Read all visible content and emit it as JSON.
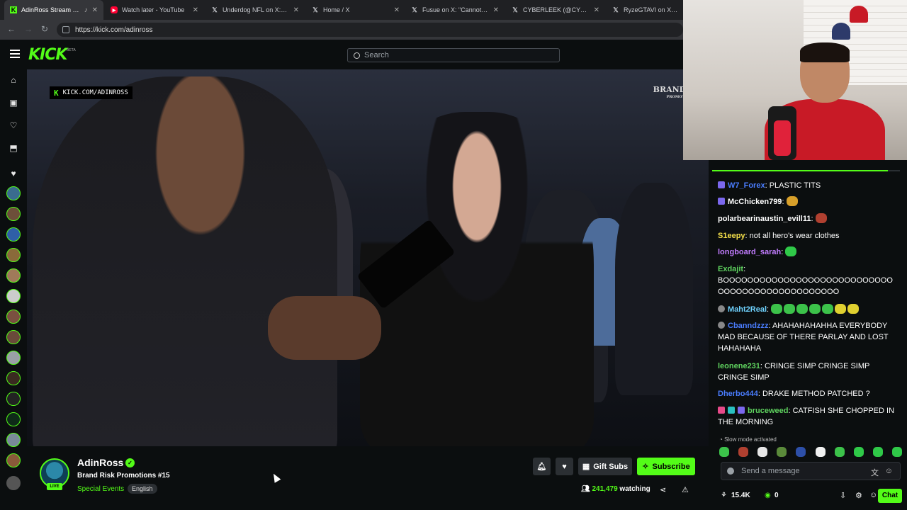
{
  "browser": {
    "tabs": [
      {
        "title": "AdinRoss Stream - Wa",
        "icon": "kick-favicon",
        "active": true
      },
      {
        "title": "Watch later - YouTube",
        "icon": "youtube-favicon"
      },
      {
        "title": "Underdog NFL on X: \"Cee",
        "icon": "x-favicon"
      },
      {
        "title": "Home / X",
        "icon": "x-favicon"
      },
      {
        "title": "Fusue on X: \"Cannot wait",
        "icon": "x-favicon"
      },
      {
        "title": "CYBERLEEK (@CYBERLEEK",
        "icon": "x-favicon"
      },
      {
        "title": "RyzeGTAVI on X: \"New GT",
        "icon": "x-favicon"
      }
    ],
    "url": "https://kick.com/adinross"
  },
  "header": {
    "logo": "KICK",
    "logo_badge": "BETA",
    "search_placeholder": "Search"
  },
  "video": {
    "watermark": "KICK.COM/ADINROSS",
    "brand_logo": "BRANDRISK",
    "brand_sub": "PROMOTIONS"
  },
  "chat": {
    "messages": [
      {
        "user": "W7_Forex",
        "color": "#4a7dff",
        "text": "PLASTIC TITS",
        "badges": [
          "#7b68ee"
        ]
      },
      {
        "user": "McChicken799",
        "color": "#ffffff",
        "text": "",
        "emotes": [
          "#d8a02a"
        ],
        "badges": [
          "#7b68ee"
        ]
      },
      {
        "user": "polarbearinaustin_evill11",
        "color": "#ffffff",
        "text": "",
        "emotes": [
          "#b04030"
        ]
      },
      {
        "user": "S1eepy",
        "color": "#f5e04a",
        "text": "not all hero's wear clothes"
      },
      {
        "user": "longboard_sarah",
        "color": "#c27cff",
        "text": "",
        "emotes": [
          "#2fc948"
        ]
      },
      {
        "user": "Exdajit",
        "color": "#5fd35f",
        "text": "BOOOOOOOOOOOOOOOOOOOOOOOOOOOOOOOOOOOOOOOOOOOOOOOO"
      },
      {
        "user": "Maht2Real",
        "color": "#6fd3ff",
        "text": "",
        "emotes": [
          "#3cc24a",
          "#3cc24a",
          "#3cc24a",
          "#3cc24a",
          "#3cc24a",
          "#e0d030",
          "#e0d030"
        ],
        "badges": [
          "#888888"
        ]
      },
      {
        "user": "Cbanndzzz",
        "color": "#4a7dff",
        "text": "AHAHAHAHAHHA EVERYBODY MAD BECAUSE OF THERE PARLAY AND LOST HAHAHAHA",
        "badges": [
          "#888888"
        ]
      },
      {
        "user": "leonene231",
        "color": "#5fd35f",
        "text": "CRINGE SIMP CRINGE SIMP CRINGE SIMP"
      },
      {
        "user": "Dherbo444",
        "color": "#4a7dff",
        "text": "DRAKE METHOD PATCHED ?"
      },
      {
        "user": "bruceweed",
        "color": "#5fd35f",
        "text": "CATFISH SHE CHOPPED IN THE MORNING",
        "badges": [
          "#e84a8a",
          "#2ac1c1",
          "#7b68ee"
        ]
      }
    ],
    "slow_mode": "Slow mode activated",
    "input_placeholder": "Send a message",
    "followers_count": "15.4K",
    "points": "0",
    "chat_button": "Chat"
  },
  "channel": {
    "name": "AdinRoss",
    "live_badge": "LIVE",
    "stream_title": "Brand Risk Promotions #15",
    "category": "Special Events",
    "language": "English",
    "gift_subs_label": "Gift Subs",
    "subscribe_label": "Subscribe",
    "viewers": "241,479",
    "watching_label": "watching"
  },
  "colors": {
    "accent": "#53fc18",
    "background": "#0b0e0f"
  }
}
